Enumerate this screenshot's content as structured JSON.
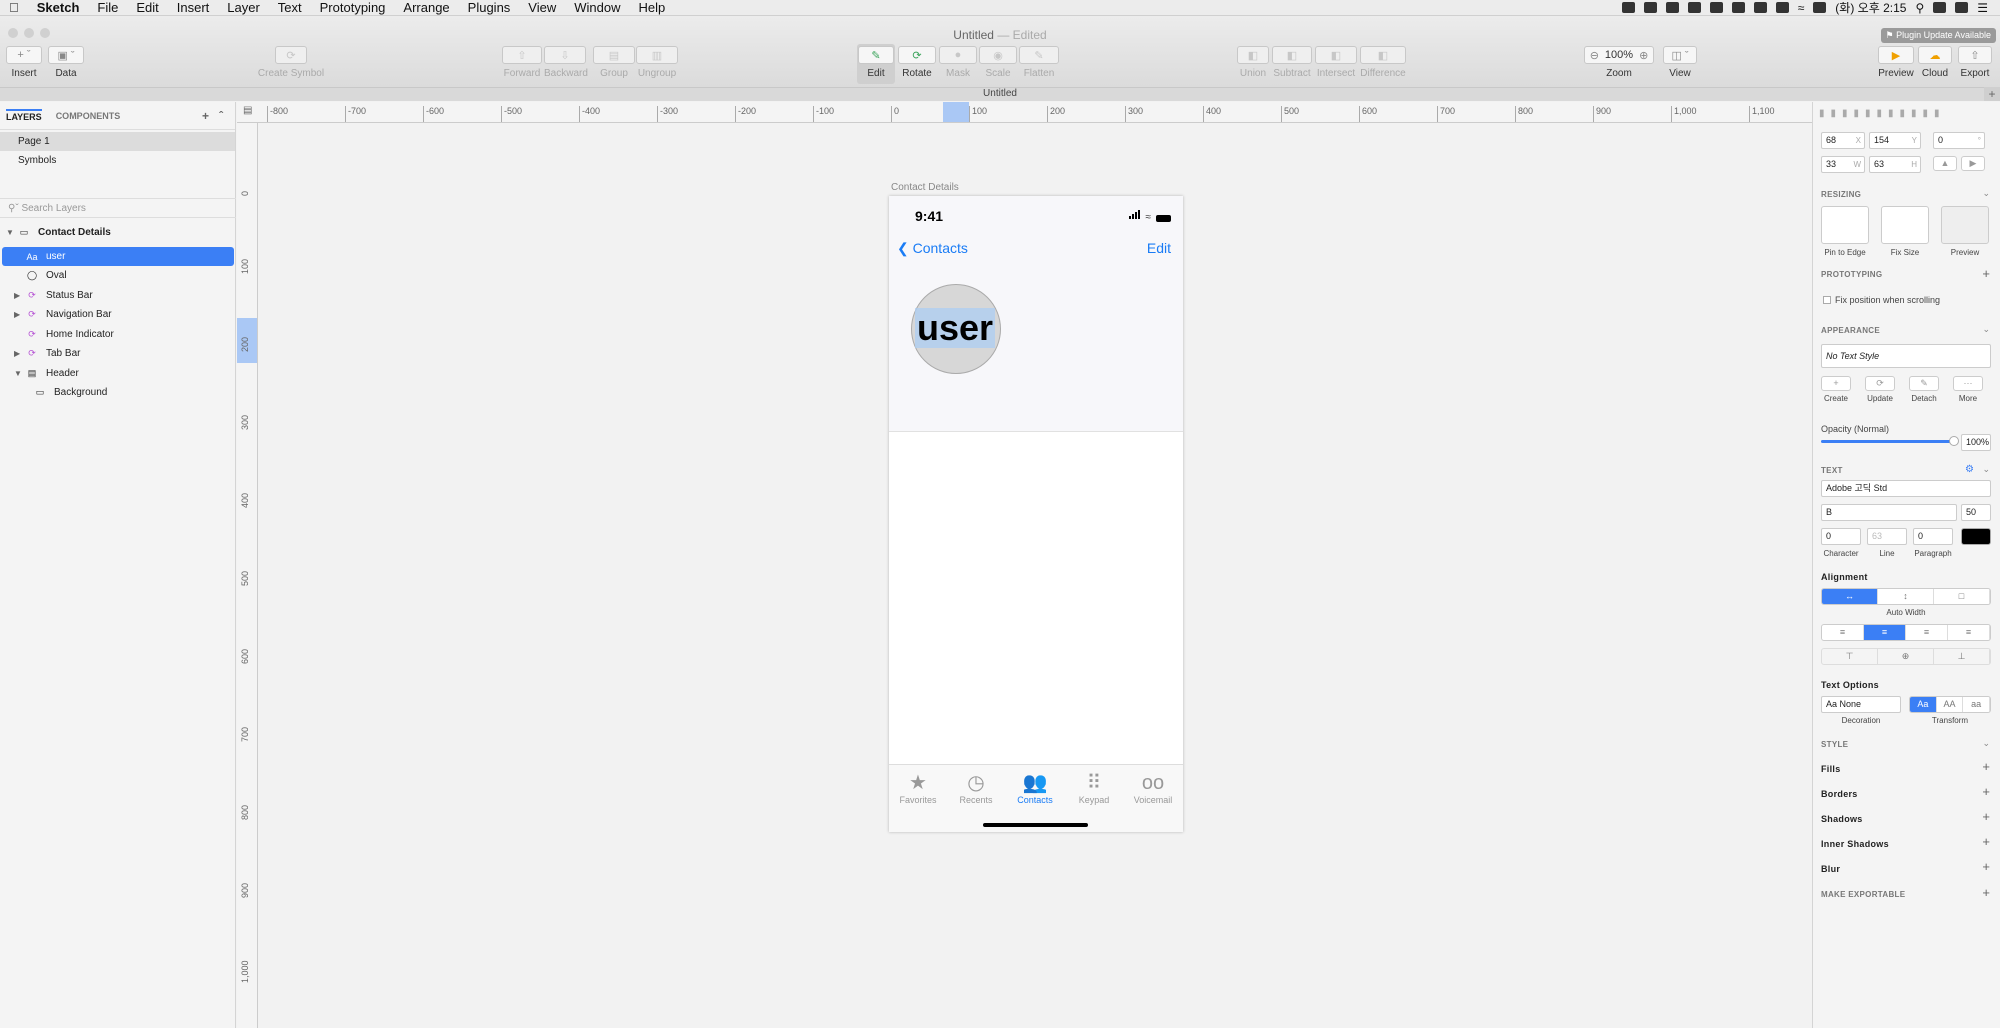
{
  "menubar": {
    "app": "Sketch",
    "items": [
      "File",
      "Edit",
      "Insert",
      "Layer",
      "Text",
      "Prototyping",
      "Arrange",
      "Plugins",
      "View",
      "Window",
      "Help"
    ],
    "clock": "(화) 오후 2:15"
  },
  "window": {
    "title": "Untitled",
    "title_suffix": "— Edited",
    "plugin_notice": "⚑ Plugin Update Available",
    "tab": "Untitled"
  },
  "toolbar": {
    "insert": "Insert",
    "data": "Data",
    "create_symbol": "Create Symbol",
    "forward": "Forward",
    "backward": "Backward",
    "group": "Group",
    "ungroup": "Ungroup",
    "edit": "Edit",
    "rotate": "Rotate",
    "mask": "Mask",
    "scale": "Scale",
    "flatten": "Flatten",
    "union": "Union",
    "subtract": "Subtract",
    "intersect": "Intersect",
    "difference": "Difference",
    "zoom": "Zoom",
    "zoom_value": "100%",
    "view": "View",
    "preview": "Preview",
    "cloud": "Cloud",
    "export": "Export"
  },
  "left_panel": {
    "tab_layers": "LAYERS",
    "tab_components": "COMPONENTS",
    "pages": [
      "Page 1",
      "Symbols"
    ],
    "search_placeholder": "Search Layers",
    "artboard": "Contact Details",
    "layers": [
      {
        "name": "user",
        "icon": "Aa"
      },
      {
        "name": "Oval",
        "icon": "oval"
      },
      {
        "name": "Status Bar",
        "icon": "symbol"
      },
      {
        "name": "Navigation Bar",
        "icon": "symbol"
      },
      {
        "name": "Home Indicator",
        "icon": "symbol"
      },
      {
        "name": "Tab Bar",
        "icon": "symbol"
      },
      {
        "name": "Header",
        "icon": "group"
      },
      {
        "name": "Background",
        "icon": "rect"
      }
    ]
  },
  "rulers": {
    "top": [
      "-800",
      "-700",
      "-600",
      "-500",
      "-400",
      "-300",
      "-200",
      "-100",
      "0",
      "100",
      "200",
      "300",
      "400",
      "500",
      "600",
      "700",
      "800",
      "900",
      "1,000",
      "1,100"
    ],
    "left": [
      "0",
      "100",
      "200",
      "300",
      "400",
      "500",
      "600",
      "700",
      "800",
      "900",
      "1,000"
    ]
  },
  "artboard": {
    "label": "Contact Details",
    "time": "9:41",
    "back_label": "Contacts",
    "edit_label": "Edit",
    "avatar_text": "user",
    "tabs": [
      {
        "label": "Favorites",
        "icon": "★"
      },
      {
        "label": "Recents",
        "icon": "◷"
      },
      {
        "label": "Contacts",
        "icon": "👥"
      },
      {
        "label": "Keypad",
        "icon": "⠿"
      },
      {
        "label": "Voicemail",
        "icon": "oo"
      }
    ],
    "active_tab": "Contacts"
  },
  "inspector": {
    "x": "68",
    "x_unit": "X",
    "y": "154",
    "y_unit": "Y",
    "rotation": "0",
    "rotation_unit": "°",
    "w": "33",
    "w_unit": "W",
    "h": "63",
    "h_unit": "H",
    "resizing": "RESIZING",
    "pin_to_edge": "Pin to Edge",
    "fix_size": "Fix Size",
    "preview": "Preview",
    "prototyping": "PROTOTYPING",
    "fix_position": "Fix position when scrolling",
    "appearance": "APPEARANCE",
    "text_style": "No Text Style",
    "create": "Create",
    "update": "Update",
    "detach": "Detach",
    "more": "More",
    "opacity_label": "Opacity (Normal)",
    "opacity_value": "100%",
    "text": "TEXT",
    "font": "Adobe 고딕 Std",
    "weight": "B",
    "size": "50",
    "character": "0",
    "line": "63",
    "paragraph": "0",
    "character_label": "Character",
    "line_label": "Line",
    "paragraph_label": "Paragraph",
    "alignment": "Alignment",
    "auto_width": "Auto Width",
    "text_options": "Text Options",
    "decoration_value": "Aa None",
    "decoration_label": "Decoration",
    "transform_label": "Transform",
    "transform_opts": [
      "Aa",
      "AA",
      "aa"
    ],
    "style": "STYLE",
    "fills": "Fills",
    "borders": "Borders",
    "shadows": "Shadows",
    "inner_shadows": "Inner Shadows",
    "blur": "Blur",
    "make_exportable": "MAKE EXPORTABLE",
    "text_color": "#000000",
    "accent": "#3b7ff5"
  }
}
